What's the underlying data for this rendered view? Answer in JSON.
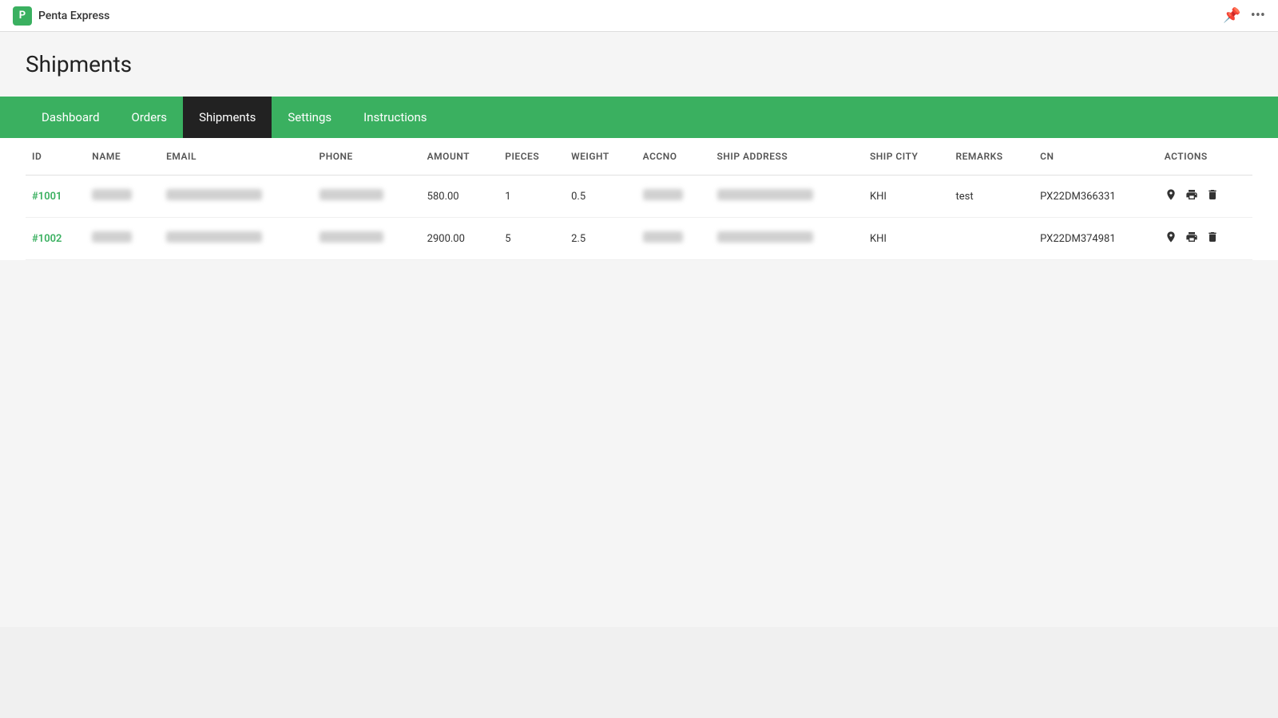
{
  "app": {
    "name": "Penta Express",
    "icon_label": "P"
  },
  "topbar": {
    "pin_icon": "📌",
    "more_icon": "···"
  },
  "page": {
    "title": "Shipments"
  },
  "nav": {
    "items": [
      {
        "label": "Dashboard",
        "active": false
      },
      {
        "label": "Orders",
        "active": false
      },
      {
        "label": "Shipments",
        "active": true
      },
      {
        "label": "Settings",
        "active": false
      },
      {
        "label": "Instructions",
        "active": false
      }
    ]
  },
  "table": {
    "columns": [
      {
        "key": "id",
        "label": "ID"
      },
      {
        "key": "name",
        "label": "NAME"
      },
      {
        "key": "email",
        "label": "EMAIL"
      },
      {
        "key": "phone",
        "label": "PHONE"
      },
      {
        "key": "amount",
        "label": "AMOUNT"
      },
      {
        "key": "pieces",
        "label": "PIECES"
      },
      {
        "key": "weight",
        "label": "WEIGHT"
      },
      {
        "key": "accno",
        "label": "ACCNO"
      },
      {
        "key": "ship_address",
        "label": "SHIP ADDRESS"
      },
      {
        "key": "ship_city",
        "label": "SHIP CITY"
      },
      {
        "key": "remarks",
        "label": "REMARKS"
      },
      {
        "key": "cn",
        "label": "CN"
      },
      {
        "key": "actions",
        "label": "ACTIONS"
      }
    ],
    "rows": [
      {
        "id": "#1001",
        "name": "BLURRED",
        "email": "BLURRED",
        "phone": "BLURRED",
        "amount": "580.00",
        "pieces": "1",
        "weight": "0.5",
        "accno": "BLURRED",
        "ship_address": "BLURRED",
        "ship_city": "KHI",
        "remarks": "test",
        "cn": "PX22DM366331"
      },
      {
        "id": "#1002",
        "name": "BLURRED",
        "email": "BLURRED",
        "phone": "BLURRED",
        "amount": "2900.00",
        "pieces": "5",
        "weight": "2.5",
        "accno": "BLURRED",
        "ship_address": "BLURRED",
        "ship_city": "KHI",
        "remarks": "",
        "cn": "PX22DM374981"
      }
    ]
  }
}
